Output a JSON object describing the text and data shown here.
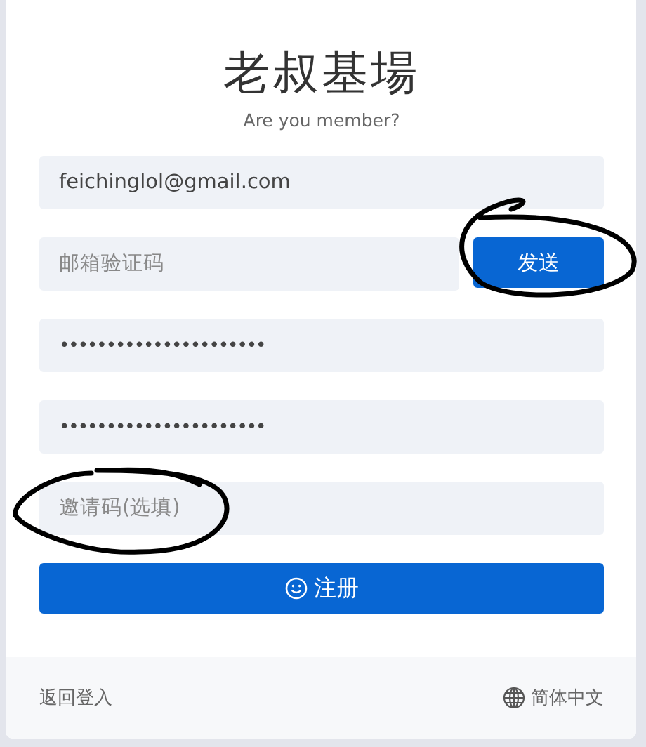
{
  "title": "老叔基場",
  "subtitle": "Are you member?",
  "email": {
    "value": "feichinglol@gmail.com"
  },
  "code": {
    "placeholder": "邮箱验证码",
    "send_button": {
      "label": "发送",
      "circled": true
    }
  },
  "password": {
    "value": "••••••••••••••••••••••"
  },
  "confirm_password": {
    "value": "••••••••••••••••••••••"
  },
  "invite": {
    "placeholder": "邀请码(选填)",
    "circled": true
  },
  "register_button": {
    "label": "注册"
  },
  "footer": {
    "back_link": "返回登入",
    "language": "简体中文"
  }
}
